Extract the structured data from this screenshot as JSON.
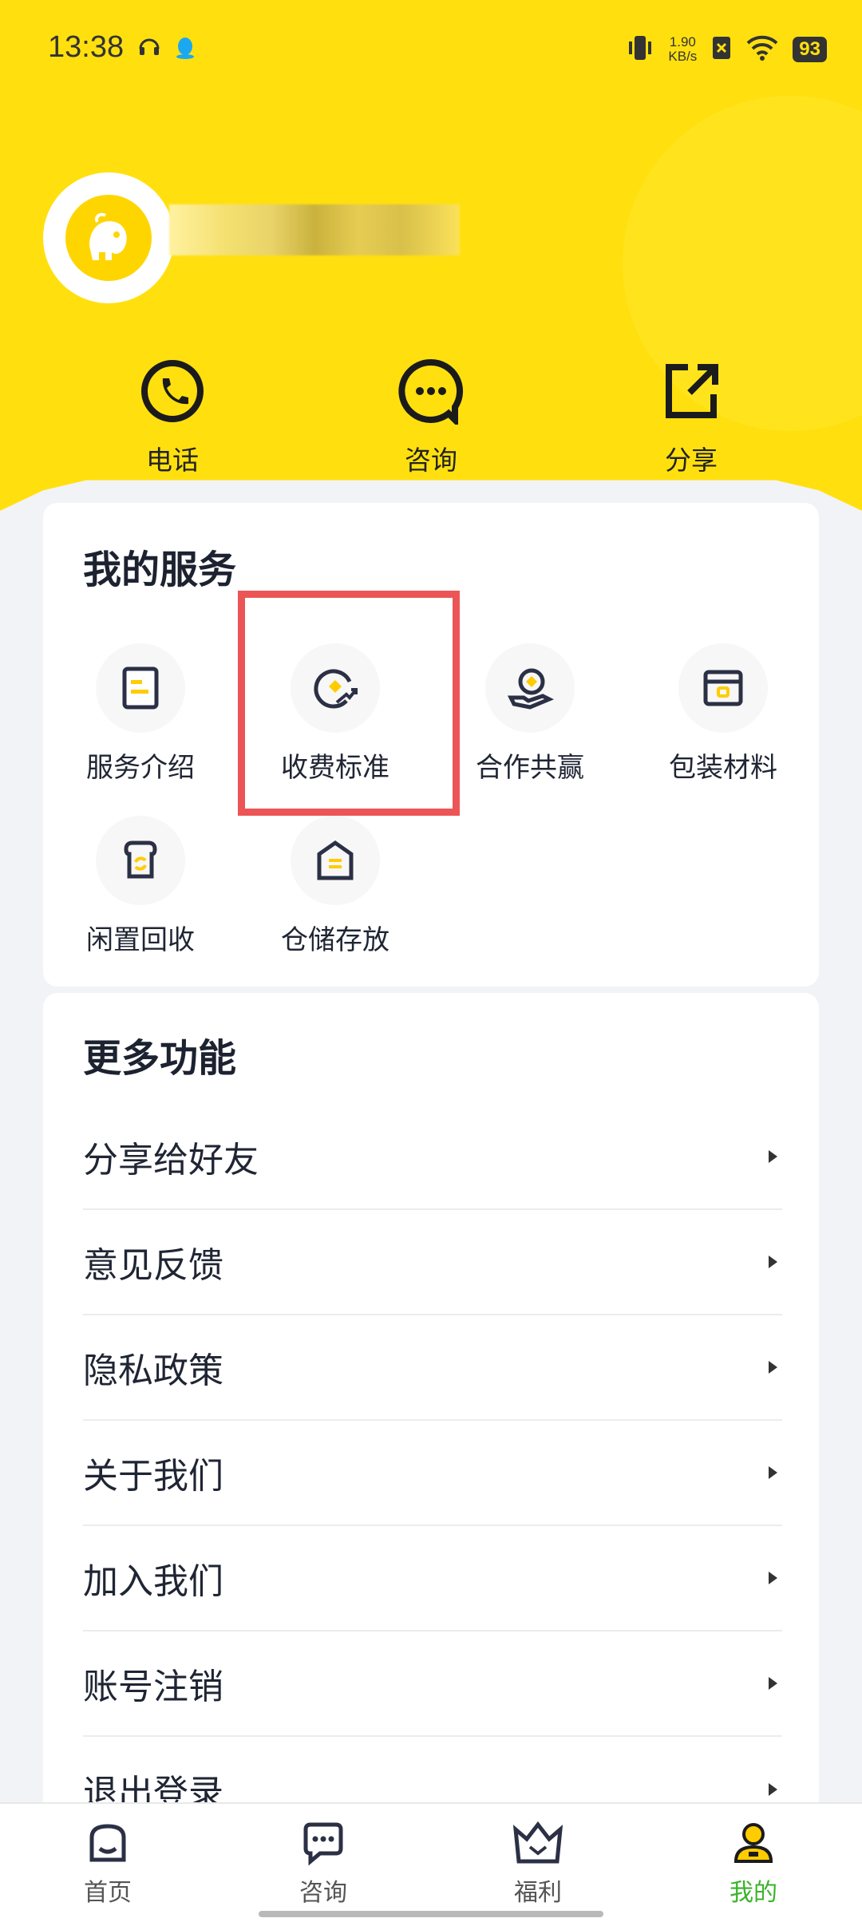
{
  "status_bar": {
    "time": "13:38",
    "speed_top": "1.90",
    "speed_bottom": "KB/s",
    "battery": "93"
  },
  "colors": {
    "brand_yellow": "#ffe00e",
    "active_green": "#3bb32a",
    "highlight_red": "#ec5555"
  },
  "quick_actions": [
    {
      "label": "电话",
      "icon": "phone-icon"
    },
    {
      "label": "咨询",
      "icon": "chat-icon"
    },
    {
      "label": "分享",
      "icon": "share-icon"
    }
  ],
  "services": {
    "title": "我的服务",
    "items": [
      {
        "label": "服务介绍",
        "icon": "document-icon"
      },
      {
        "label": "收费标准",
        "icon": "pricing-icon"
      },
      {
        "label": "合作共赢",
        "icon": "cooperation-icon"
      },
      {
        "label": "包装材料",
        "icon": "package-icon"
      },
      {
        "label": "闲置回收",
        "icon": "recycle-icon"
      },
      {
        "label": "仓储存放",
        "icon": "warehouse-icon"
      }
    ]
  },
  "more": {
    "title": "更多功能",
    "items": [
      {
        "label": "分享给好友"
      },
      {
        "label": "意见反馈"
      },
      {
        "label": "隐私政策"
      },
      {
        "label": "关于我们"
      },
      {
        "label": "加入我们"
      },
      {
        "label": "账号注销"
      },
      {
        "label": "退出登录"
      }
    ]
  },
  "bottom_nav": [
    {
      "label": "首页",
      "icon": "home-icon",
      "active": false
    },
    {
      "label": "咨询",
      "icon": "chat-bubble-icon",
      "active": false
    },
    {
      "label": "福利",
      "icon": "crown-icon",
      "active": false
    },
    {
      "label": "我的",
      "icon": "profile-icon",
      "active": true
    }
  ]
}
